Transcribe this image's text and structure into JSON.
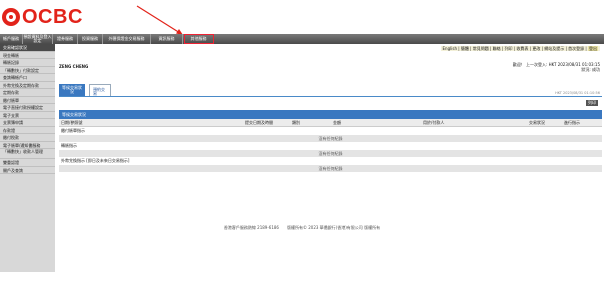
{
  "brand": {
    "name": "OCBC",
    "color": "#e2231a"
  },
  "nav": {
    "tabs": [
      {
        "label": "帳戶服務"
      },
      {
        "label": "預設資料及登入設定"
      },
      {
        "label": "證券服務"
      },
      {
        "label": "投資服務"
      },
      {
        "label": "外匯保證金交易服務"
      },
      {
        "label": "資訊服務"
      },
      {
        "label": "其他服務"
      }
    ]
  },
  "sidebar": {
    "items": [
      {
        "label": "交易確認狀況",
        "active": true
      },
      {
        "label": "現金轉賬"
      },
      {
        "label": "轉賬記錄"
      },
      {
        "label": "「轉數快」付款設定"
      },
      {
        "label": "查詢轉帳戶口"
      },
      {
        "label": "外幣兌換及定期存款"
      },
      {
        "label": "定期存款"
      },
      {
        "label": "繳付賬單"
      },
      {
        "label": "電子直接付款授權設定"
      },
      {
        "label": "電子支票"
      },
      {
        "label": "支票簿申請"
      },
      {
        "label": "存款證"
      },
      {
        "label": "繳付稅款"
      },
      {
        "label": "電子賬單/通知書服務"
      },
      {
        "label": "「轉數快」收款人管理"
      },
      {
        "label": "雙重認證"
      },
      {
        "label": "開戶及查詢"
      }
    ]
  },
  "toplinks": {
    "items": [
      "English",
      "簡體",
      "常見問題",
      "聯絡",
      "列印",
      "收費表",
      "更改",
      "網站及提示",
      "首次登錄"
    ],
    "exit": "登出"
  },
  "customer": {
    "name": "ZENG CHENG"
  },
  "welcome": {
    "line1": "歡迎！ 上一次登入: HKT 2023/08/31 01:03:15",
    "line2": "狀況: 成功"
  },
  "tabs": {
    "active": "等候交易狀況",
    "other": "預約交易",
    "timestamp": "HKT 2023/08/31 01:10:56"
  },
  "print_label": "列印",
  "panel": {
    "title": "等候交易狀況",
    "columns": [
      "日期/參照號",
      "提交日期及時間",
      "類別",
      "金額",
      "用於/付款人",
      "交易狀況",
      "進行指示"
    ],
    "sections": [
      {
        "title": "繳付賬單指示",
        "empty": "沒有任何紀錄"
      },
      {
        "title": "轉賬指示",
        "empty": "沒有任何紀錄"
      },
      {
        "title": "外幣兌換指示 [即日及未來日交易指示]",
        "empty": "沒有任何紀錄"
      }
    ]
  },
  "footer": {
    "text": "香港客戶服務熱線 2189-6186　　版權所有© 2023 華僑銀行(香港)有限公司 版權所有"
  }
}
